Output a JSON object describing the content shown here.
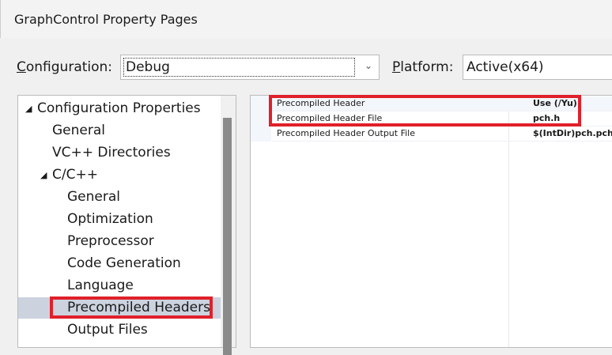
{
  "window": {
    "title": "GraphControl Property Pages"
  },
  "config": {
    "label_u": "C",
    "label_rest": "onfiguration:",
    "value": "Debug",
    "platform_label_u": "P",
    "platform_label_rest": "latform:",
    "platform_value": "Active(x64)"
  },
  "tree": [
    {
      "label": "Configuration Properties",
      "level": 0,
      "expanded": true
    },
    {
      "label": "General",
      "level": 1
    },
    {
      "label": "VC++ Directories",
      "level": 1
    },
    {
      "label": "C/C++",
      "level": 1,
      "expanded": true
    },
    {
      "label": "General",
      "level": 2
    },
    {
      "label": "Optimization",
      "level": 2
    },
    {
      "label": "Preprocessor",
      "level": 2
    },
    {
      "label": "Code Generation",
      "level": 2
    },
    {
      "label": "Language",
      "level": 2
    },
    {
      "label": "Precompiled Headers",
      "level": 2,
      "selected": true
    },
    {
      "label": "Output Files",
      "level": 2
    }
  ],
  "properties": [
    {
      "name": "Precompiled Header",
      "value": "Use (/Yu)"
    },
    {
      "name": "Precompiled Header File",
      "value": "pch.h"
    },
    {
      "name": "Precompiled Header Output File",
      "value": "$(IntDir)pch.pch"
    }
  ],
  "colors": {
    "highlight": "#e0202a",
    "selected": "#ccd3df"
  }
}
